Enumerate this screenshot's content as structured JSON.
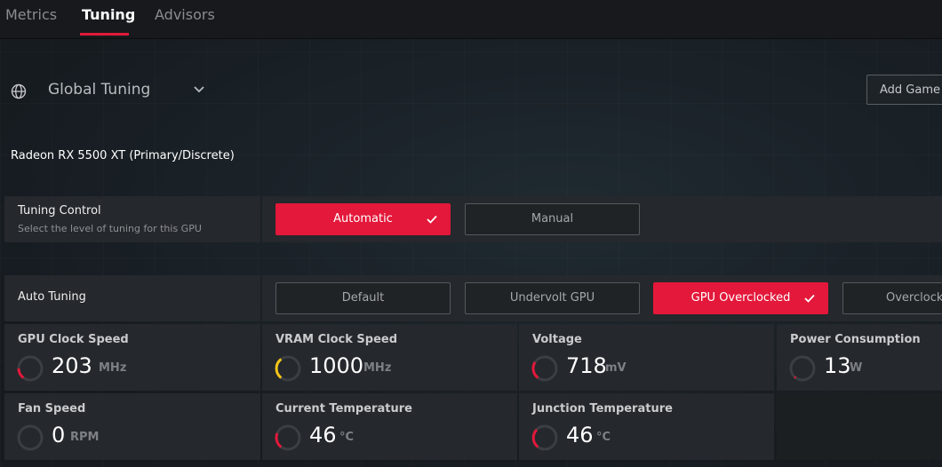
{
  "tabs": [
    {
      "label": "Metrics",
      "active": false
    },
    {
      "label": "Tuning",
      "active": true
    },
    {
      "label": "Advisors",
      "active": false
    }
  ],
  "profile": {
    "icon": "globe-icon",
    "name": "Global Tuning",
    "dropdown_icon": "chevron-down-icon"
  },
  "add_game_button": "Add Game P",
  "gpu_name": "Radeon RX 5500 XT (Primary/Discrete)",
  "tuning_control": {
    "title": "Tuning Control",
    "subtitle": "Select the level of tuning for this GPU",
    "options": [
      {
        "label": "Automatic",
        "selected": true
      },
      {
        "label": "Manual",
        "selected": false
      }
    ]
  },
  "auto_tuning": {
    "title": "Auto Tuning",
    "options": [
      {
        "label": "Default",
        "selected": false
      },
      {
        "label": "Undervolt GPU",
        "selected": false
      },
      {
        "label": "GPU Overclocked",
        "selected": true
      },
      {
        "label": "Overclock V",
        "selected": false
      }
    ]
  },
  "metrics": [
    {
      "title": "GPU Clock Speed",
      "value": "203",
      "unit": "MHz",
      "gauge_color": "#e3183a"
    },
    {
      "title": "VRAM Clock Speed",
      "value": "1000",
      "unit": "MHz",
      "gauge_color": "#f2c418"
    },
    {
      "title": "Voltage",
      "value": "718",
      "unit": "mV",
      "gauge_color": "#e3183a"
    },
    {
      "title": "Power Consumption",
      "value": "13",
      "unit": "W",
      "gauge_color": "#e3183a"
    },
    {
      "title": "Fan Speed",
      "value": "0",
      "unit": "RPM",
      "gauge_color": "#e3183a"
    },
    {
      "title": "Current Temperature",
      "value": "46",
      "unit": "°C",
      "gauge_color": "#e3183a"
    },
    {
      "title": "Junction Temperature",
      "value": "46",
      "unit": "°C",
      "gauge_color": "#e3183a"
    }
  ],
  "colors": {
    "accent": "#e3183a",
    "warning": "#f2c418"
  }
}
